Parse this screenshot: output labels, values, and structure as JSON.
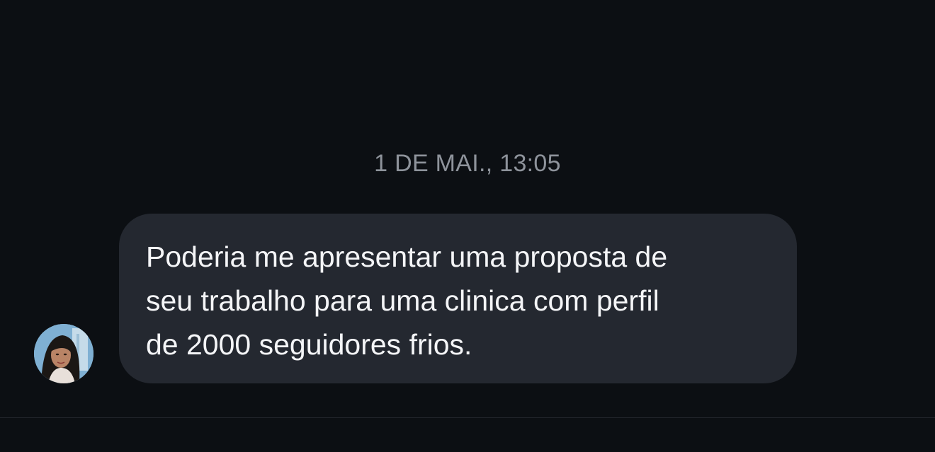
{
  "conversation": {
    "timestamp": "1 DE MAI., 13:05",
    "messages": [
      {
        "sender": "incoming",
        "text": "Poderia me apresentar uma proposta de\nseu trabalho para uma clinica com perfil\nde 2000 seguidores frios."
      }
    ]
  },
  "icons": {
    "avatar": "profile-photo"
  },
  "colors": {
    "background": "#0c0f13",
    "bubble": "#242830",
    "message_text": "#f4f5f7",
    "timestamp_text": "#8e939b"
  }
}
